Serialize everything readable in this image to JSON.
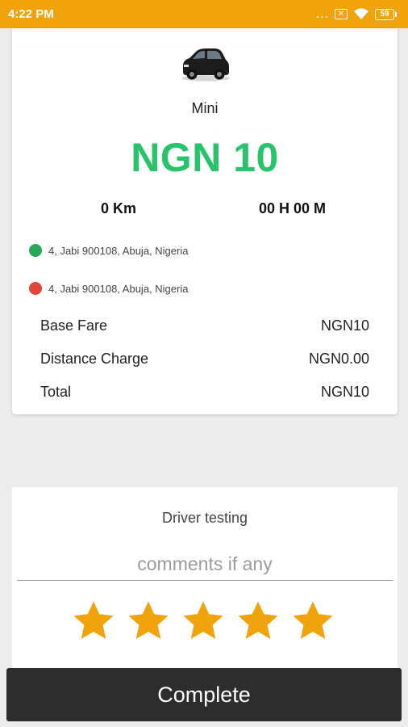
{
  "status_bar": {
    "time": "4:22 PM",
    "dots": "...",
    "notification_glyph": "✕",
    "battery": "59"
  },
  "trip": {
    "car_icon": "car-icon",
    "car_type": "Mini",
    "fare_amount": "NGN 10",
    "distance": "0 Km",
    "duration": "00 H 00 M",
    "pickup_address": "4, Jabi 900108, Abuja, Nigeria",
    "drop_address": "4, Jabi 900108, Abuja, Nigeria"
  },
  "fare_breakdown": [
    {
      "label": "Base Fare",
      "value": "NGN10"
    },
    {
      "label": "Distance Charge",
      "value": "NGN0.00"
    },
    {
      "label": "Total",
      "value": "NGN10"
    }
  ],
  "rating": {
    "driver_name": "Driver testing",
    "comments_placeholder": "comments if any",
    "comments_value": "",
    "stars_total": 5,
    "stars_selected": 5
  },
  "complete_label": "Complete",
  "colors": {
    "status_bar": "#f0a30a",
    "fare_amount": "#27c46b",
    "pickup_dot": "#27a85a",
    "drop_dot": "#e0463a",
    "star": "#f0a30a",
    "complete_button": "#2d2d2d"
  }
}
